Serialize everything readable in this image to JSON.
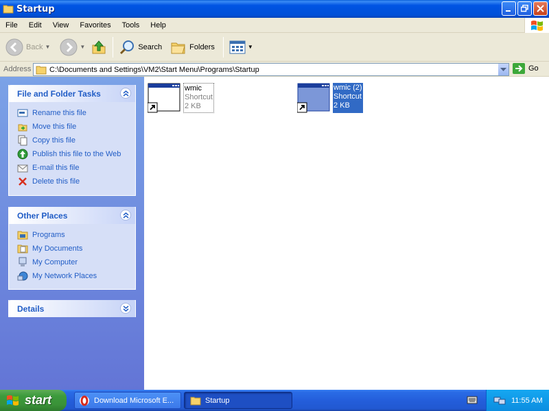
{
  "window": {
    "title": "Startup"
  },
  "menu": [
    "File",
    "Edit",
    "View",
    "Favorites",
    "Tools",
    "Help"
  ],
  "toolbar": {
    "back": "Back",
    "search": "Search",
    "folders": "Folders"
  },
  "address": {
    "label": "Address",
    "path": "C:\\Documents and Settings\\VM2\\Start Menu\\Programs\\Startup",
    "go": "Go"
  },
  "panels": {
    "file_tasks": {
      "title": "File and Folder Tasks",
      "items": [
        "Rename this file",
        "Move this file",
        "Copy this file",
        "Publish this file to the Web",
        "E-mail this file",
        "Delete this file"
      ]
    },
    "other_places": {
      "title": "Other Places",
      "items": [
        "Programs",
        "My Documents",
        "My Computer",
        "My Network Places"
      ]
    },
    "details": {
      "title": "Details"
    }
  },
  "files": [
    {
      "name": "wmic",
      "type": "Shortcut",
      "size": "2 KB"
    },
    {
      "name": "wmic (2)",
      "type": "Shortcut",
      "size": "2 KB"
    }
  ],
  "taskbar": {
    "start": "start",
    "tasks": [
      "Download Microsoft E...",
      "Startup"
    ],
    "clock": "11:55 AM"
  }
}
